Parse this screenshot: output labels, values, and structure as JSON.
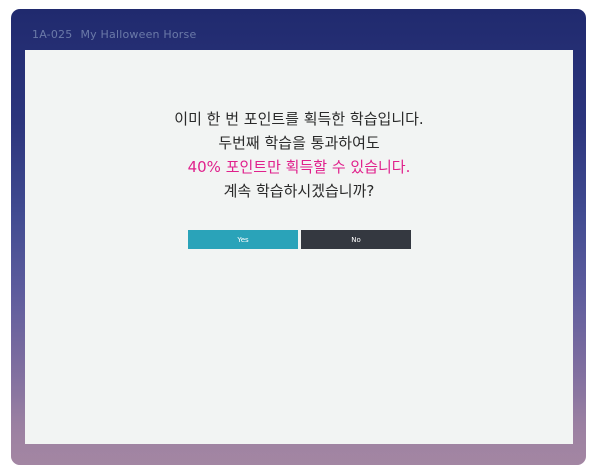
{
  "header": {
    "code": "1A-025",
    "title": "My Halloween Horse"
  },
  "dialog": {
    "line1": "이미 한 번 포인트를 획득한 학습입니다.",
    "line2": "두번째 학습을 통과하여도",
    "line3": "40% 포인트만 획득할 수 있습니다.",
    "line4": "계속 학습하시겠습니까?",
    "highlight_color": "#e0218c",
    "yes_label": "Yes",
    "no_label": "No",
    "yes_color": "#2aa3b9",
    "no_color": "#343840"
  }
}
